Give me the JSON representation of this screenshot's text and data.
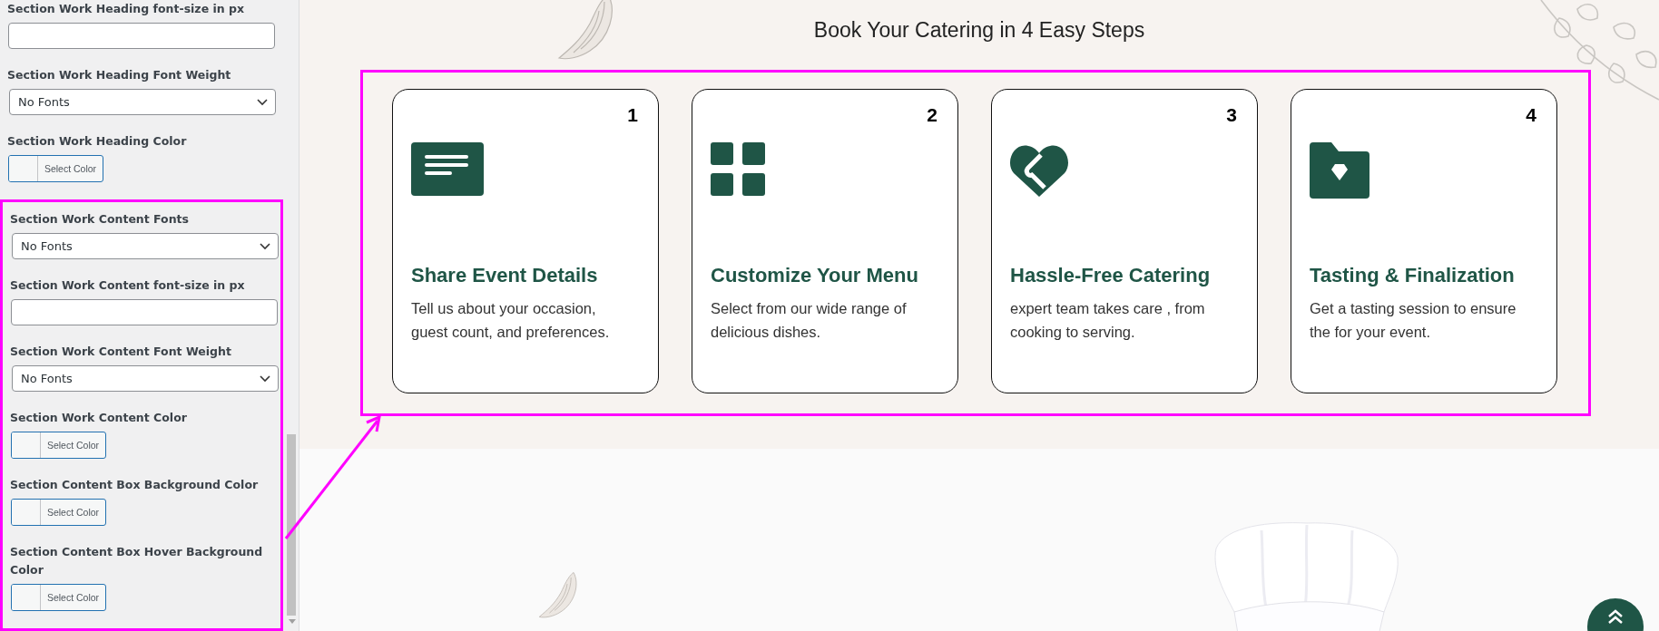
{
  "sidebar": {
    "fields": [
      {
        "kind": "text",
        "label": "Section Work Heading font-size in px"
      },
      {
        "kind": "select",
        "label": "Section Work Heading Font Weight",
        "value": "No Fonts"
      },
      {
        "kind": "color",
        "label": "Section Work Heading Color",
        "value": "Select Color"
      }
    ],
    "highlighted_fields": [
      {
        "kind": "select",
        "label": "Section Work Content Fonts",
        "value": "No Fonts"
      },
      {
        "kind": "text",
        "label": "Section Work Content font-size in px"
      },
      {
        "kind": "select",
        "label": "Section Work Content Font Weight",
        "value": "No Fonts"
      },
      {
        "kind": "color",
        "label": "Section Work Content Color",
        "value": "Select Color"
      },
      {
        "kind": "color",
        "label": "Section Content Box Background Color",
        "value": "Select Color"
      },
      {
        "kind": "color",
        "label": "Section Content Box Hover Background Color",
        "value": "Select Color"
      }
    ]
  },
  "main": {
    "heading": "Book Your Catering in 4 Easy Steps",
    "steps": [
      {
        "number": "1",
        "title": "Share Event Details",
        "text": "Tell us about your occasion, guest count, and preferences."
      },
      {
        "number": "2",
        "title": "Customize Your Menu",
        "text": "Select from our wide range of delicious dishes."
      },
      {
        "number": "3",
        "title": "Hassle-Free Catering",
        "text": "expert team takes care , from cooking to serving."
      },
      {
        "number": "4",
        "title": "Tasting & Finalization",
        "text": "Get a tasting session to ensure the for your event."
      }
    ]
  }
}
